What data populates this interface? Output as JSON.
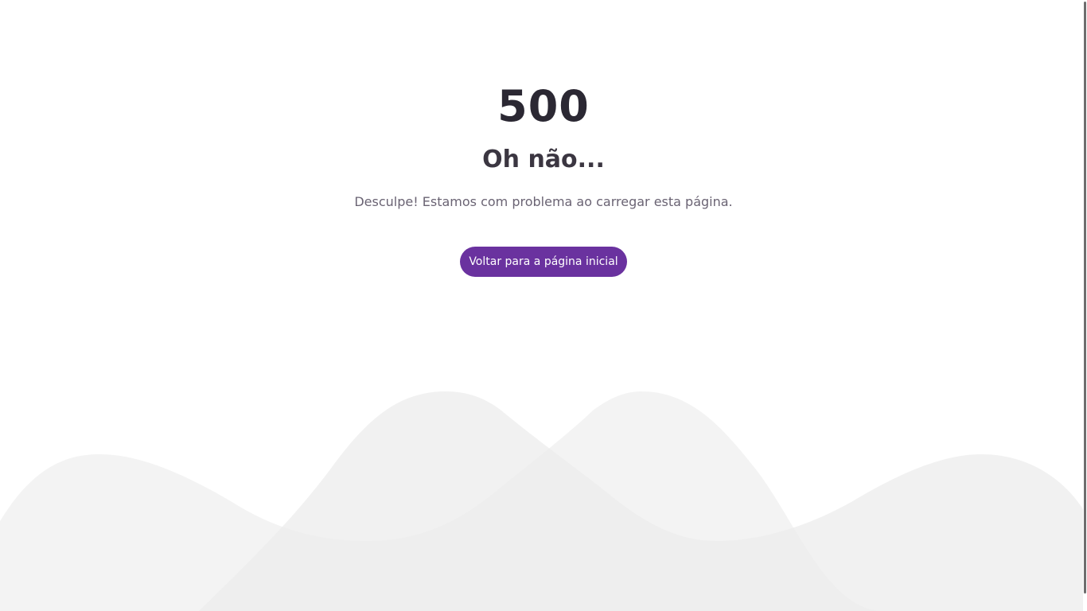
{
  "error": {
    "code": "500",
    "title": "Oh não...",
    "message": "Desculpe! Estamos com problema ao carregar esta página."
  },
  "actions": {
    "home_label": "Voltar para a página inicial"
  },
  "colors": {
    "accent": "#6a329f",
    "heading": "#2b2833",
    "text": "#6a6373",
    "wave_light": "#f2f2f2",
    "wave_overlap": "#e6e6e6"
  }
}
